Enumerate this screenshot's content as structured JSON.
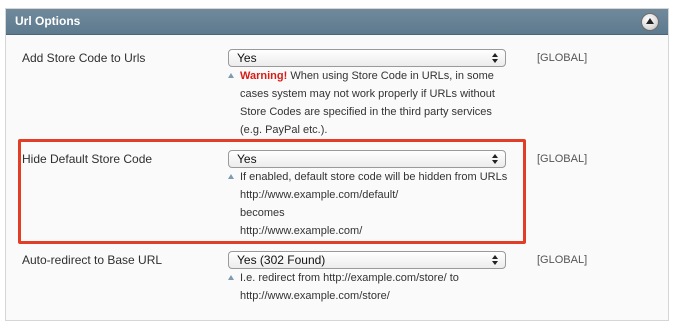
{
  "section": {
    "title": "Url Options"
  },
  "rows": [
    {
      "label": "Add Store Code to Urls",
      "value": "Yes",
      "scope": "[GLOBAL]",
      "note_warning": "Warning!",
      "note_lines": [
        "When using Store Code in URLs, in some",
        "cases system may not work properly if URLs without",
        "Store Codes are specified in the third party services",
        "(e.g. PayPal etc.)."
      ]
    },
    {
      "label": "Hide Default Store Code",
      "value": "Yes",
      "scope": "[GLOBAL]",
      "note_lines": [
        "If enabled, default store code will be hidden from URLs",
        "http://www.example.com/default/",
        "becomes",
        "http://www.example.com/"
      ]
    },
    {
      "label": "Auto-redirect to Base URL",
      "value": "Yes (302 Found)",
      "scope": "[GLOBAL]",
      "note_lines": [
        "I.e. redirect from http://example.com/store/ to",
        "http://www.example.com/store/"
      ]
    }
  ],
  "colors": {
    "header": "#5e7a8e",
    "warning": "#d71c16",
    "highlight": "#e23d27"
  }
}
